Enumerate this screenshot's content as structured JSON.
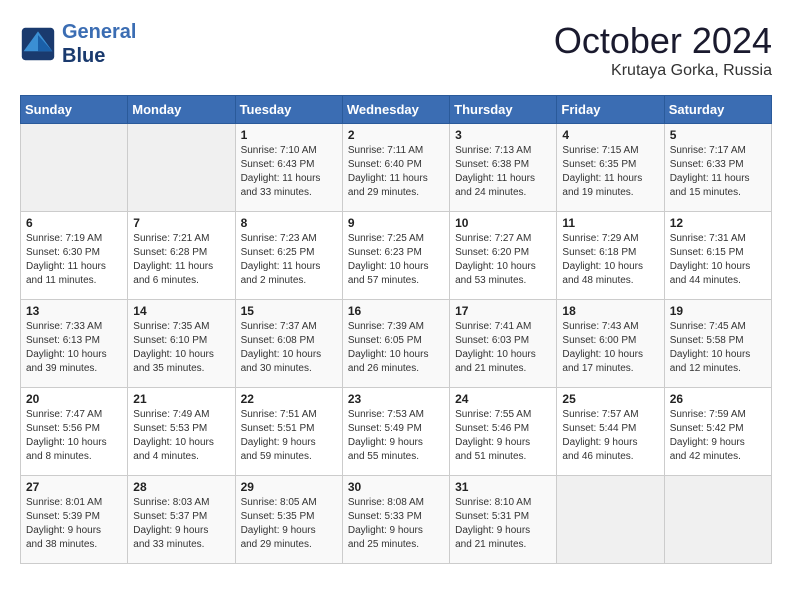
{
  "header": {
    "logo_line1": "General",
    "logo_line2": "Blue",
    "month_year": "October 2024",
    "location": "Krutaya Gorka, Russia"
  },
  "weekdays": [
    "Sunday",
    "Monday",
    "Tuesday",
    "Wednesday",
    "Thursday",
    "Friday",
    "Saturday"
  ],
  "weeks": [
    [
      {
        "day": "",
        "info": ""
      },
      {
        "day": "",
        "info": ""
      },
      {
        "day": "1",
        "info": "Sunrise: 7:10 AM\nSunset: 6:43 PM\nDaylight: 11 hours\nand 33 minutes."
      },
      {
        "day": "2",
        "info": "Sunrise: 7:11 AM\nSunset: 6:40 PM\nDaylight: 11 hours\nand 29 minutes."
      },
      {
        "day": "3",
        "info": "Sunrise: 7:13 AM\nSunset: 6:38 PM\nDaylight: 11 hours\nand 24 minutes."
      },
      {
        "day": "4",
        "info": "Sunrise: 7:15 AM\nSunset: 6:35 PM\nDaylight: 11 hours\nand 19 minutes."
      },
      {
        "day": "5",
        "info": "Sunrise: 7:17 AM\nSunset: 6:33 PM\nDaylight: 11 hours\nand 15 minutes."
      }
    ],
    [
      {
        "day": "6",
        "info": "Sunrise: 7:19 AM\nSunset: 6:30 PM\nDaylight: 11 hours\nand 11 minutes."
      },
      {
        "day": "7",
        "info": "Sunrise: 7:21 AM\nSunset: 6:28 PM\nDaylight: 11 hours\nand 6 minutes."
      },
      {
        "day": "8",
        "info": "Sunrise: 7:23 AM\nSunset: 6:25 PM\nDaylight: 11 hours\nand 2 minutes."
      },
      {
        "day": "9",
        "info": "Sunrise: 7:25 AM\nSunset: 6:23 PM\nDaylight: 10 hours\nand 57 minutes."
      },
      {
        "day": "10",
        "info": "Sunrise: 7:27 AM\nSunset: 6:20 PM\nDaylight: 10 hours\nand 53 minutes."
      },
      {
        "day": "11",
        "info": "Sunrise: 7:29 AM\nSunset: 6:18 PM\nDaylight: 10 hours\nand 48 minutes."
      },
      {
        "day": "12",
        "info": "Sunrise: 7:31 AM\nSunset: 6:15 PM\nDaylight: 10 hours\nand 44 minutes."
      }
    ],
    [
      {
        "day": "13",
        "info": "Sunrise: 7:33 AM\nSunset: 6:13 PM\nDaylight: 10 hours\nand 39 minutes."
      },
      {
        "day": "14",
        "info": "Sunrise: 7:35 AM\nSunset: 6:10 PM\nDaylight: 10 hours\nand 35 minutes."
      },
      {
        "day": "15",
        "info": "Sunrise: 7:37 AM\nSunset: 6:08 PM\nDaylight: 10 hours\nand 30 minutes."
      },
      {
        "day": "16",
        "info": "Sunrise: 7:39 AM\nSunset: 6:05 PM\nDaylight: 10 hours\nand 26 minutes."
      },
      {
        "day": "17",
        "info": "Sunrise: 7:41 AM\nSunset: 6:03 PM\nDaylight: 10 hours\nand 21 minutes."
      },
      {
        "day": "18",
        "info": "Sunrise: 7:43 AM\nSunset: 6:00 PM\nDaylight: 10 hours\nand 17 minutes."
      },
      {
        "day": "19",
        "info": "Sunrise: 7:45 AM\nSunset: 5:58 PM\nDaylight: 10 hours\nand 12 minutes."
      }
    ],
    [
      {
        "day": "20",
        "info": "Sunrise: 7:47 AM\nSunset: 5:56 PM\nDaylight: 10 hours\nand 8 minutes."
      },
      {
        "day": "21",
        "info": "Sunrise: 7:49 AM\nSunset: 5:53 PM\nDaylight: 10 hours\nand 4 minutes."
      },
      {
        "day": "22",
        "info": "Sunrise: 7:51 AM\nSunset: 5:51 PM\nDaylight: 9 hours\nand 59 minutes."
      },
      {
        "day": "23",
        "info": "Sunrise: 7:53 AM\nSunset: 5:49 PM\nDaylight: 9 hours\nand 55 minutes."
      },
      {
        "day": "24",
        "info": "Sunrise: 7:55 AM\nSunset: 5:46 PM\nDaylight: 9 hours\nand 51 minutes."
      },
      {
        "day": "25",
        "info": "Sunrise: 7:57 AM\nSunset: 5:44 PM\nDaylight: 9 hours\nand 46 minutes."
      },
      {
        "day": "26",
        "info": "Sunrise: 7:59 AM\nSunset: 5:42 PM\nDaylight: 9 hours\nand 42 minutes."
      }
    ],
    [
      {
        "day": "27",
        "info": "Sunrise: 8:01 AM\nSunset: 5:39 PM\nDaylight: 9 hours\nand 38 minutes."
      },
      {
        "day": "28",
        "info": "Sunrise: 8:03 AM\nSunset: 5:37 PM\nDaylight: 9 hours\nand 33 minutes."
      },
      {
        "day": "29",
        "info": "Sunrise: 8:05 AM\nSunset: 5:35 PM\nDaylight: 9 hours\nand 29 minutes."
      },
      {
        "day": "30",
        "info": "Sunrise: 8:08 AM\nSunset: 5:33 PM\nDaylight: 9 hours\nand 25 minutes."
      },
      {
        "day": "31",
        "info": "Sunrise: 8:10 AM\nSunset: 5:31 PM\nDaylight: 9 hours\nand 21 minutes."
      },
      {
        "day": "",
        "info": ""
      },
      {
        "day": "",
        "info": ""
      }
    ]
  ]
}
